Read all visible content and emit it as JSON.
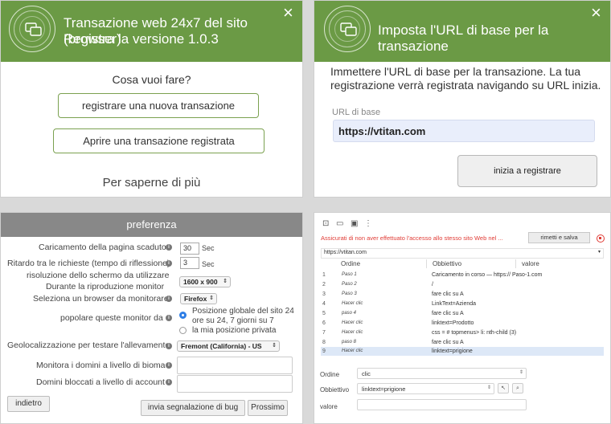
{
  "colors": {
    "header_green": "#6b9a45",
    "button_border": "#7ba150",
    "warning_red": "#e03b35",
    "selected_row": "#dde8f7"
  },
  "panel_record": {
    "title_line1": "Transazione web 24x7 del sito (browser)",
    "title_line2": "Registra la versione 1.0.3",
    "question": "Cosa vuoi fare?",
    "btn_new": "registrare una nuova transazione",
    "btn_open": "Aprire una transazione registrata",
    "learn_more": "Per saperne di più",
    "close_icon": "×"
  },
  "panel_base_url": {
    "title": "Imposta l'URL di base per la transazione",
    "instruction": "Immettere l'URL di base per la transazione. La tua registrazione verrà registrata navigando su URL inizia.",
    "field_label": "URL di base",
    "field_value": "https://vtitan.com",
    "start_button": "inizia a registrare",
    "close_icon": "×"
  },
  "panel_preferences": {
    "header": "preferenza",
    "timeout_label": "Caricamento della pagina scaduto",
    "timeout_value": "30",
    "timeout_unit": "Sec",
    "delay_label": "Ritardo tra le richieste (tempo di riflessione)",
    "delay_value": "3",
    "delay_unit": "Sec",
    "resolution_label_1": "risoluzione dello schermo da utilizzare",
    "resolution_label_2": "Durante la riproduzione monitor",
    "resolution_value": "1600 x 900",
    "browser_label": "Seleziona un browser da monitorare",
    "browser_value": "Firefox",
    "populate_label": "popolare queste monitor da",
    "radio_global_1": "Posizione globale del sito 24",
    "radio_global_2": "ore su 24, 7 giorni su 7",
    "radio_private": "la mia posizione privata",
    "geo_label": "Geolocalizzazione per testare l'allevamento",
    "geo_value": "Fremont (California) - US",
    "domains_label": "Monitora i domini a livello di bioma",
    "blocked_label": "Domini bloccati a livello di account",
    "back_button": "indietro",
    "bug_button": "invia segnalazione di bug",
    "next_button": "Prossimo"
  },
  "panel_steps": {
    "warning": "Assicurati di non aver effettuato l'accesso allo stesso sito Web nel ...",
    "save_button": "rimetti e salva",
    "url": "https://vtitan.com",
    "col_order": "Ordine",
    "col_target": "Obbiettivo",
    "col_value": "valore",
    "rows": [
      {
        "n": "1",
        "cmd": "Paso 1",
        "target": "Caricamento in corso — https:// Paso-1.com"
      },
      {
        "n": "2",
        "cmd": "Paso 2",
        "target": "/"
      },
      {
        "n": "3",
        "cmd": "Paso 3",
        "target": "fare clic su A"
      },
      {
        "n": "4",
        "cmd": "Hacer clic",
        "target": "LinkText=Azienda"
      },
      {
        "n": "5",
        "cmd": "paso 4",
        "target": "fare clic su A"
      },
      {
        "n": "6",
        "cmd": "Hacer clic",
        "target": "linktext=Prodotto"
      },
      {
        "n": "7",
        "cmd": "Hacer clic",
        "target": "css = # topmenus> li: nth-child  (3)"
      },
      {
        "n": "8",
        "cmd": "paso 8",
        "target": "fare clic su A"
      },
      {
        "n": "9",
        "cmd": "Hacer clic",
        "target": "linktext=prigione"
      }
    ],
    "form_order_label": "Ordine",
    "form_order_value": "clic",
    "form_target_label": "Obbiettivo",
    "form_target_value": "linktext=prigione",
    "form_value_label": "valore"
  }
}
